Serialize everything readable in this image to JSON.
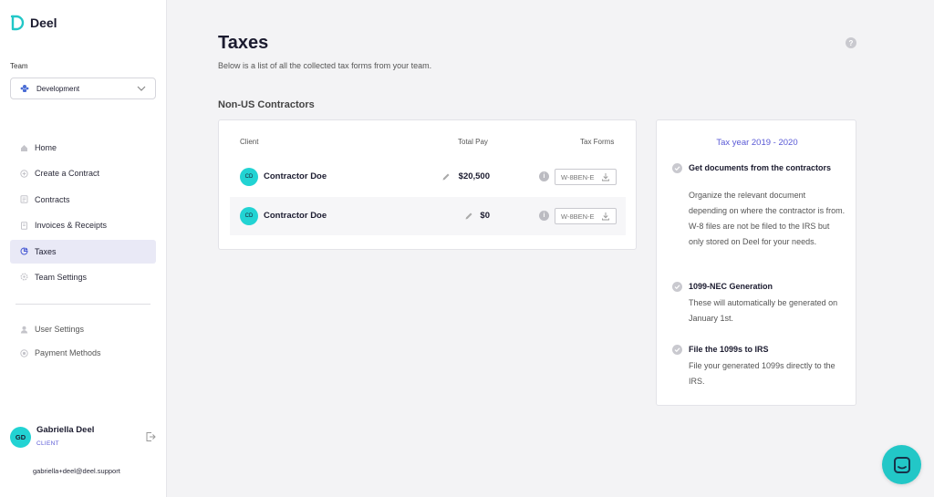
{
  "app": {
    "name": "Deel"
  },
  "team": {
    "label": "Team",
    "selected": "Development"
  },
  "nav": {
    "home": "Home",
    "create_contract": "Create a Contract",
    "contracts": "Contracts",
    "invoices": "Invoices & Receipts",
    "taxes": "Taxes",
    "team_settings": "Team Settings",
    "user_settings": "User Settings",
    "payment_methods": "Payment Methods"
  },
  "profile": {
    "initials": "GD",
    "name": "Gabriella Deel",
    "role": "CLIENT",
    "email": "gabriella+deel@deel.support"
  },
  "page": {
    "title": "Taxes",
    "subtitle": "Below is a list of all the collected tax forms from your team.",
    "help": "?",
    "section": "Non-US Contractors"
  },
  "table": {
    "headers": {
      "client": "Client",
      "total_pay": "Total Pay",
      "tax_forms": "Tax Forms"
    },
    "rows": [
      {
        "initials": "CD",
        "name": "Contractor Doe",
        "pay": "$20,500",
        "form": "W-8BEN-E"
      },
      {
        "initials": "CD",
        "name": "Contractor Doe",
        "pay": "$0",
        "form": "W-8BEN-E"
      }
    ],
    "info_icon": "i"
  },
  "info": {
    "tax_year": "Tax year 2019 - 2020",
    "steps": [
      {
        "title": "Get documents from the contractors",
        "body": "Organize the relevant document depending on where the contractor is from. W-8 files are not be filed to the IRS but only stored on Deel for your needs."
      },
      {
        "title": "1099-NEC Generation",
        "body": "These will automatically be generated on January 1st."
      },
      {
        "title": "File the 1099s to IRS",
        "body": "File your generated 1099s directly to the IRS."
      }
    ]
  },
  "colors": {
    "accent": "#22d3d3",
    "link": "#5a5ad6",
    "active_nav": "#e9e9f6"
  }
}
